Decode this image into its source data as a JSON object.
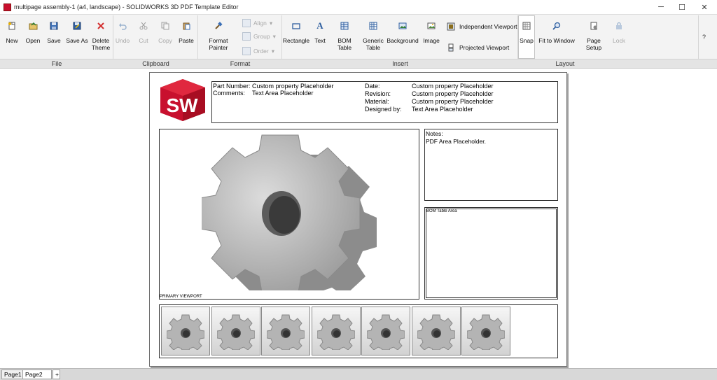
{
  "window": {
    "title": "multipage assembly-1 (a4, landscape) - SOLIDWORKS 3D PDF Template Editor",
    "controls": [
      "─",
      "☐",
      "✕"
    ]
  },
  "ribbon": {
    "file": {
      "new": "New",
      "open": "Open",
      "save": "Save",
      "save_as": "Save As",
      "delete_theme_1": "Delete",
      "delete_theme_2": "Theme"
    },
    "clipboard": {
      "undo": "Undo",
      "cut": "Cut",
      "copy": "Copy",
      "paste": "Paste"
    },
    "format": {
      "format_painter": "Format Painter",
      "align": "Align",
      "group": "Group",
      "order": "Order"
    },
    "insert": {
      "rectangle": "Rectangle",
      "text": "Text",
      "bom_table": "BOM Table",
      "generic_table_1": "Generic",
      "generic_table_2": "Table",
      "background": "Background",
      "image": "Image",
      "independent_viewport": "Independent Viewport",
      "projected_viewport": "Projected Viewport"
    },
    "layout": {
      "snap": "Snap",
      "fit_to_window": "Fit to Window",
      "page_setup": "Page Setup",
      "lock": "Lock"
    },
    "help": "?",
    "groups": {
      "file": "File",
      "clipboard": "Clipboard",
      "format": "Format",
      "insert": "Insert",
      "layout": "Layout"
    }
  },
  "template": {
    "logo_text": "SW",
    "header": {
      "part_number_label": "Part Number:",
      "part_number_value": "Custom property Placeholder",
      "comments_label": "Comments:",
      "comments_value": "Text Area Placeholder",
      "date_label": "Date:",
      "date_value": "Custom property Placeholder",
      "revision_label": "Revision:",
      "revision_value": "Custom property Placeholder",
      "material_label": "Material:",
      "material_value": "Custom property Placeholder",
      "designed_by_label": "Designed by:",
      "designed_by_value": "Text Area Placeholder"
    },
    "primary_viewport_label": "PRIMARY VIEWPORT",
    "notes_title": "Notes:",
    "notes_text": "PDF Area Placeholder.",
    "bom_label": "BOM Table Area",
    "thumbnail_count": 7
  },
  "tabs": {
    "page1": "Page1",
    "page2": "Page2",
    "add": "+"
  },
  "colors": {
    "logo_red": "#c8102e",
    "ribbon_bg": "#f3f3f3",
    "group_bar": "#e4e4e4",
    "tab_bar": "#d8d8d8"
  }
}
